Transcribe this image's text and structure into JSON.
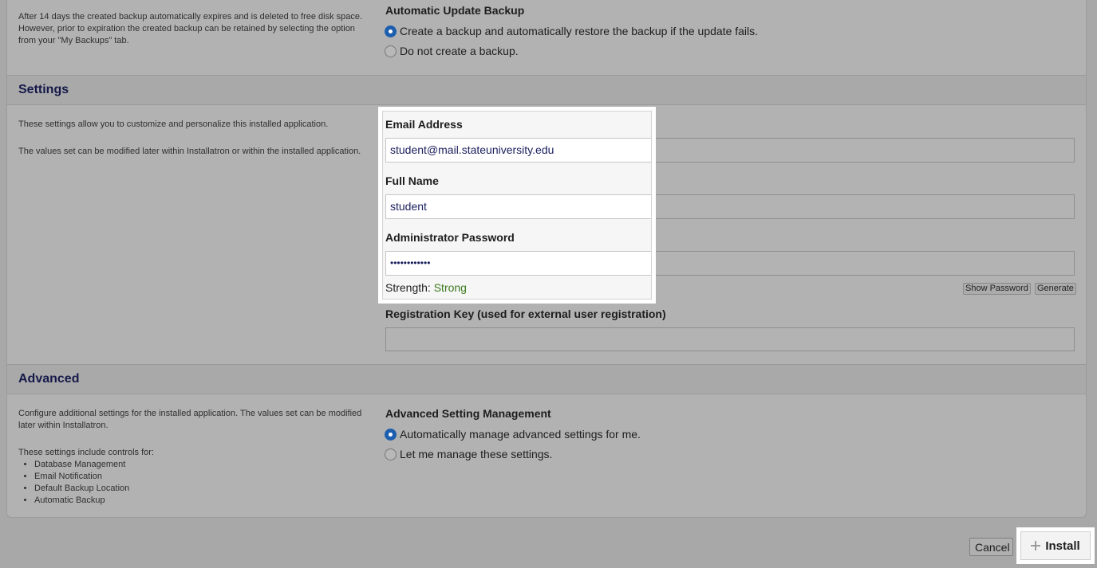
{
  "backup": {
    "desc": "After 14 days the created backup automatically expires and is deleted to free disk space. However, prior to expiration the created backup can be retained by selecting the option from your \"My Backups\" tab.",
    "label": "Automatic Update Backup",
    "option_create": "Create a backup and automatically restore the backup if the update fails.",
    "option_none": "Do not create a backup.",
    "selected": "option_create"
  },
  "settings": {
    "title": "Settings",
    "desc1": "These settings allow you to customize and personalize this installed application.",
    "desc2": "The values set can be modified later within Installatron or within the installed application.",
    "email_label": "Email Address",
    "email_value": "student@mail.stateuniversity.edu",
    "name_label": "Full Name",
    "name_value": "student",
    "password_label": "Administrator Password",
    "password_value": "••••••••••••",
    "strength_label": "Strength:",
    "strength_value": "Strong",
    "show_password": "Show Password",
    "generate": "Generate",
    "regkey_label": "Registration Key (used for external user registration)",
    "regkey_value": ""
  },
  "advanced": {
    "title": "Advanced",
    "desc1": "Configure additional settings for the installed application. The values set can be modified later within Installatron.",
    "desc2": "These settings include controls for:",
    "items": [
      "Database Management",
      "Email Notification",
      "Default Backup Location",
      "Automatic Backup"
    ],
    "label": "Advanced Setting Management",
    "option_auto": "Automatically manage advanced settings for me.",
    "option_manual": "Let me manage these settings.",
    "selected": "option_auto"
  },
  "footer": {
    "cancel": "Cancel",
    "install": "Install"
  },
  "colors": {
    "accent": "#1d5fae",
    "title": "#15194a",
    "strong": "#3c7a1c"
  }
}
